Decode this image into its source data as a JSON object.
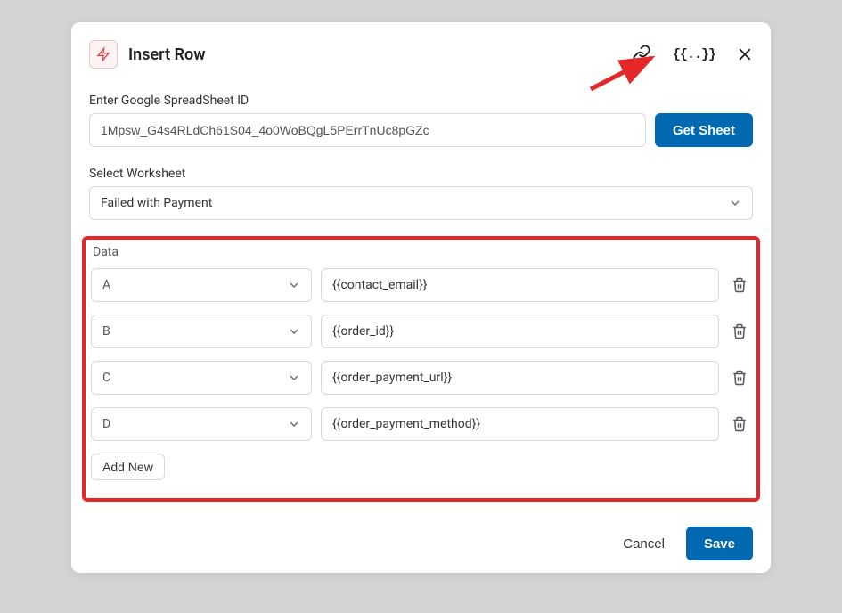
{
  "modal": {
    "title": "Insert Row",
    "spreadsheet": {
      "label": "Enter Google SpreadSheet ID",
      "value": "1Mpsw_G4s4RLdCh61S04_4o0WoBQgL5PErrTnUc8pGZc",
      "button": "Get Sheet"
    },
    "worksheet": {
      "label": "Select Worksheet",
      "value": "Failed with Payment"
    },
    "data": {
      "label": "Data",
      "rows": [
        {
          "col": "A",
          "val": "{{contact_email}}"
        },
        {
          "col": "B",
          "val": "{{order_id}}"
        },
        {
          "col": "C",
          "val": "{{order_payment_url}}"
        },
        {
          "col": "D",
          "val": "{{order_payment_method}}"
        }
      ],
      "add": "Add New"
    },
    "footer": {
      "cancel": "Cancel",
      "save": "Save"
    }
  }
}
